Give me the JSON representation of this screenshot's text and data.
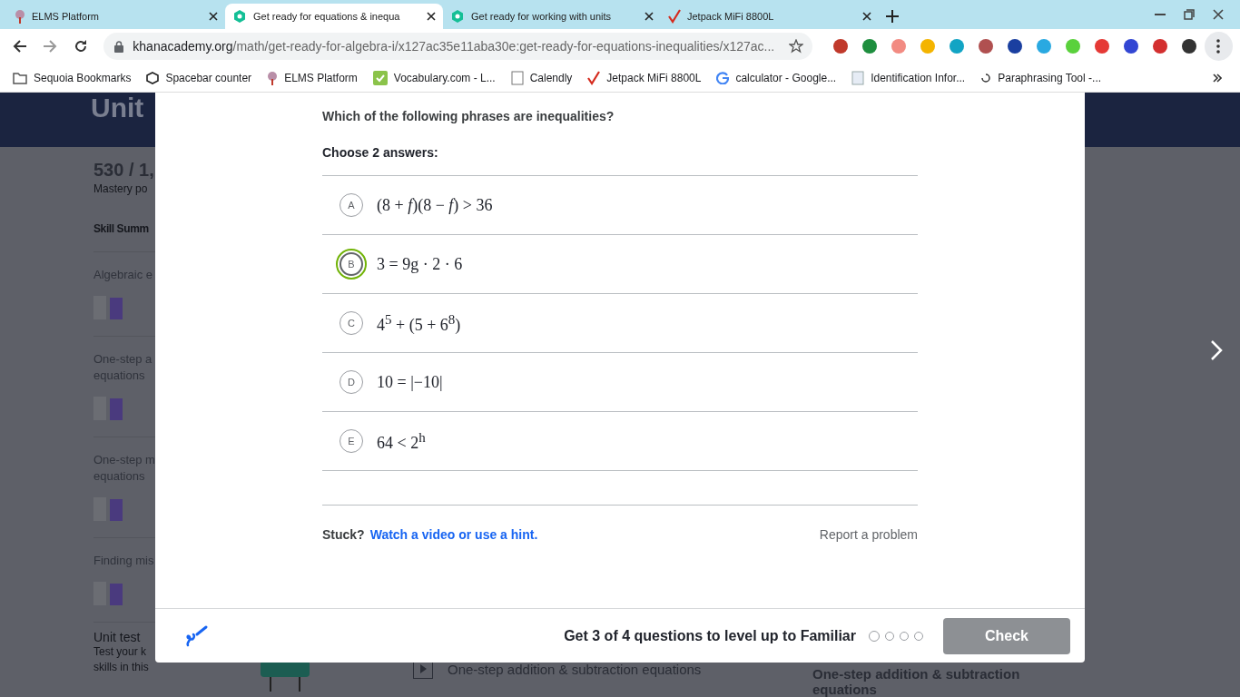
{
  "browser": {
    "tabs": [
      {
        "title": "ELMS Platform",
        "kind": "tree",
        "selected": false
      },
      {
        "title": "Get ready for equations & inequa",
        "kind": "khan",
        "selected": true
      },
      {
        "title": "Get ready for working with units",
        "kind": "khan",
        "selected": false
      },
      {
        "title": "Jetpack MiFi 8800L",
        "kind": "check",
        "selected": false
      }
    ],
    "address": {
      "host": "khanacademy.org",
      "path": "/math/get-ready-for-algebra-i/x127ac35e11aba30e:get-ready-for-equations-inequalities/x127ac..."
    },
    "bookmarks": [
      {
        "label": "Sequoia Bookmarks",
        "kind": "folder"
      },
      {
        "label": "Spacebar counter",
        "kind": "cube"
      },
      {
        "label": "ELMS Platform",
        "kind": "tree"
      },
      {
        "label": "Vocabulary.com - L...",
        "kind": "vocab"
      },
      {
        "label": "Calendly",
        "kind": "page"
      },
      {
        "label": "Jetpack MiFi 8800L",
        "kind": "check"
      },
      {
        "label": "calculator - Google...",
        "kind": "google"
      },
      {
        "label": "Identification Infor...",
        "kind": "doc"
      },
      {
        "label": "Paraphrasing Tool -...",
        "kind": "swirl"
      }
    ]
  },
  "page": {
    "heading": "Unit",
    "points": "530 / 1,",
    "points_caption": "Mastery po",
    "section_title": "Skill Summ",
    "skills": [
      {
        "lines": [
          "Algebraic e"
        ]
      },
      {
        "lines": [
          "One-step a",
          "equations"
        ]
      },
      {
        "lines": [
          "One-step m",
          "equations"
        ]
      },
      {
        "lines": [
          "Finding mis"
        ]
      }
    ],
    "unit_test": {
      "title": "Unit test",
      "lines": [
        "Test your k",
        "skills in this"
      ]
    },
    "lesson": "One-step addition & subtraction equations",
    "card_title": "One-step addition & subtraction equations"
  },
  "modal": {
    "question": "Which of the following phrases are inequalities?",
    "instruction": "Choose 2 answers:",
    "choices": [
      {
        "letter": "A",
        "math": "(8 + *f*)(8 − *f*) > 36",
        "selected": false
      },
      {
        "letter": "B",
        "math": "3 = 9g · 2 · 6",
        "selected": true
      },
      {
        "letter": "C",
        "math": "4$^{5}$ + (5 + 6$^{8}$)",
        "selected": false
      },
      {
        "letter": "D",
        "math": "10 = |−10|",
        "selected": false
      },
      {
        "letter": "E",
        "math": "64 < 2$^{h}$",
        "selected": false
      }
    ],
    "stuck": "Stuck?",
    "hint_link": "Watch a video or use a hint.",
    "report": "Report a problem",
    "progress_text": "Get 3 of 4 questions to level up to Familiar",
    "progress_dots": [
      {
        "current": true
      },
      {
        "current": false
      },
      {
        "current": false
      },
      {
        "current": false
      }
    ],
    "check": {
      "label": "Check",
      "disabled": true
    }
  }
}
